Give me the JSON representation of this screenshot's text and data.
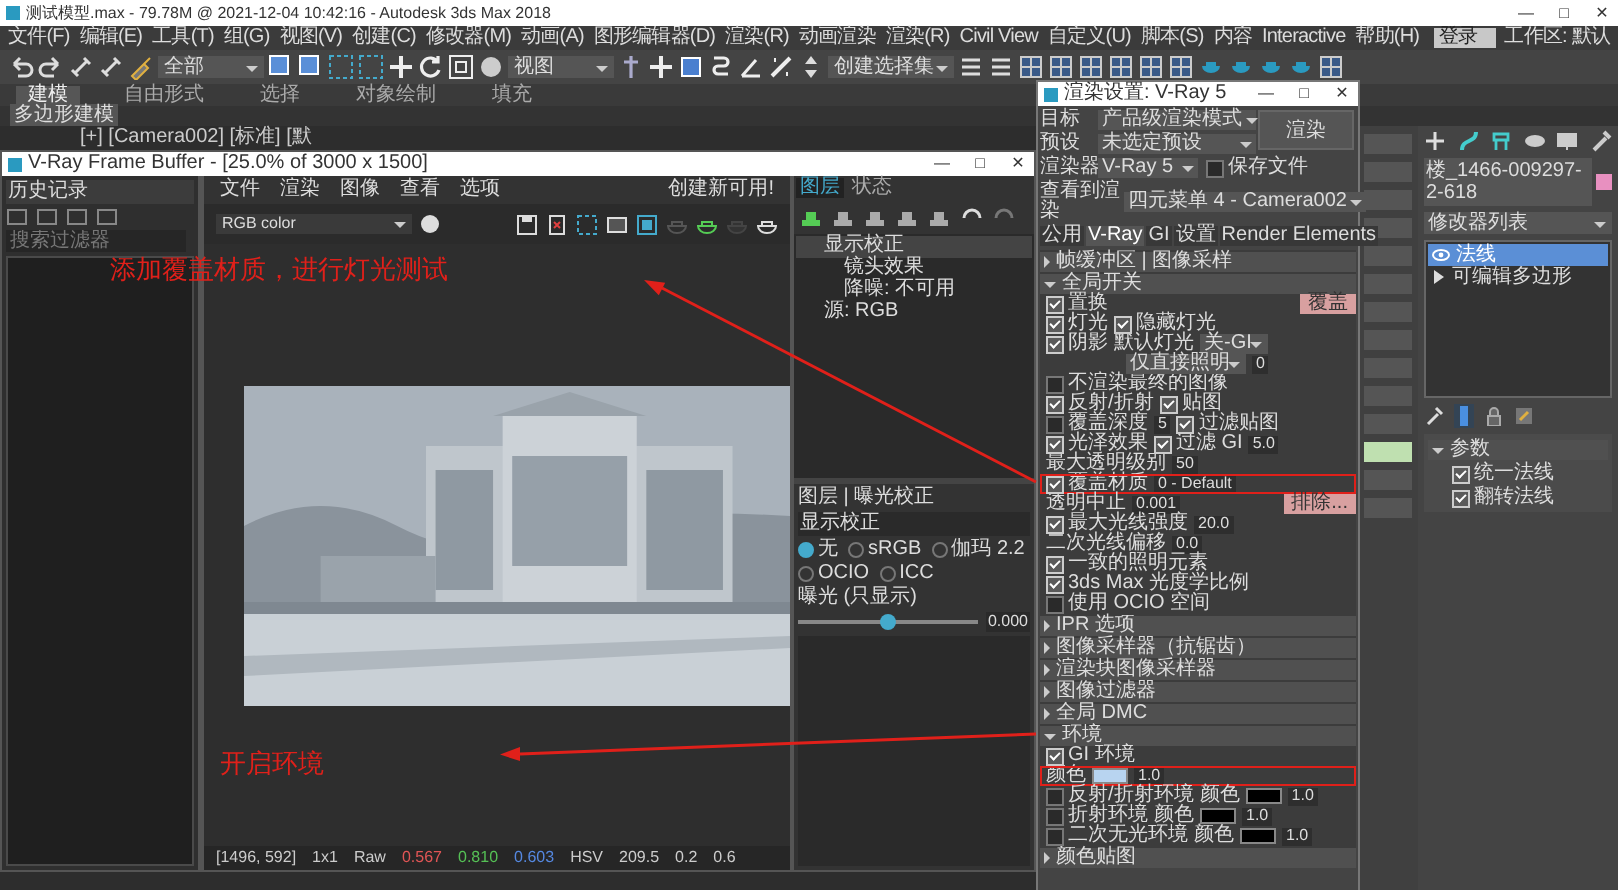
{
  "title_bar": {
    "title": "测试模型.max - 79.78M @ 2021-12-04 10:42:16 - Autodesk 3ds Max 2018",
    "controls": [
      "—",
      "□",
      "✕"
    ]
  },
  "menu_bar": [
    "文件(F)",
    "编辑(E)",
    "工具(T)",
    "组(G)",
    "视图(V)",
    "创建(C)",
    "修改器(M)",
    "动画(A)",
    "图形编辑器(D)",
    "渲染(R)",
    "动画渲染",
    "渲染(R)",
    "Civil View",
    "自定义(U)",
    "脚本(S)",
    "内容",
    "Interactive",
    "帮助(H)"
  ],
  "login": "登录",
  "workspace": "工作区: 默认",
  "toolbar": {
    "dropdowns": [
      "全部",
      "视图",
      "创建选择集"
    ]
  },
  "ribbon_tabs": [
    {
      "label": "建模",
      "selected": true
    },
    {
      "label": "自由形式",
      "selected": false
    },
    {
      "label": "选择",
      "selected": false
    },
    {
      "label": "对象绘制",
      "selected": false
    },
    {
      "label": "填充",
      "selected": false
    }
  ],
  "ribbon_panel": "多边形建模",
  "viewport_label": "[+] [Camera002] [标准] [默",
  "vfb": {
    "title": "V-Ray Frame Buffer - [25.0% of 3000 x 1500]",
    "controls": [
      "—",
      "□",
      "✕"
    ],
    "menus": [
      "文件",
      "渲染",
      "图像",
      "查看",
      "选项"
    ],
    "notice": "创建新可用!",
    "history_title": "历史记录",
    "history_search": {
      "placeholder": "搜索过滤器"
    },
    "channel": "RGB color",
    "layer_tabs": [
      {
        "label": "图层",
        "selected": true
      },
      {
        "label": "状态",
        "selected": false
      }
    ],
    "layers": [
      {
        "label": "显示校正",
        "selected": true,
        "children": [
          {
            "label": "镜头效果",
            "selected": false
          },
          {
            "label": "降噪: 不可用",
            "selected": false
          }
        ]
      },
      {
        "label": "源: RGB",
        "selected": false
      }
    ],
    "properties": {
      "title": "图层 | 曝光校正",
      "field": "显示校正",
      "options": [
        {
          "label": "无",
          "selected": true
        },
        {
          "label": "sRGB",
          "selected": false
        },
        {
          "label": "伽玛 2.2",
          "selected": false
        },
        {
          "label": "OCIO",
          "selected": false
        },
        {
          "label": "ICC",
          "selected": false
        }
      ],
      "slider": {
        "label": "曝光 (只显示)",
        "level": 0.5,
        "reading": "0.000"
      }
    },
    "status": [
      {
        "text": "[1496, 592]",
        "color": "#cccccc"
      },
      {
        "text": "1x1",
        "color": "#cccccc"
      },
      {
        "text": "Raw",
        "color": "#cccccc"
      },
      {
        "text": "0.567",
        "color": "#e05555"
      },
      {
        "text": "0.810",
        "color": "#55c055"
      },
      {
        "text": "0.603",
        "color": "#5588e0"
      },
      {
        "text": "HSV",
        "color": "#cccccc"
      },
      {
        "text": "209.5",
        "color": "#cccccc"
      },
      {
        "text": "0.2",
        "color": "#cccccc"
      },
      {
        "text": "0.6",
        "color": "#cccccc"
      }
    ]
  },
  "render_setup": {
    "title": "渲染设置: V-Ray 5",
    "controls": [
      "—",
      "□",
      "✕"
    ],
    "fields": [
      {
        "label": "目标",
        "value": "产品级渲染模式"
      },
      {
        "label": "预设",
        "value": "未选定预设"
      },
      {
        "label": "渲染器",
        "value": "V-Ray 5"
      }
    ],
    "render_button": "渲染",
    "save_file": {
      "label": "保存文件",
      "checked": false
    },
    "view": {
      "label": "查看到渲染",
      "value": "四元菜单 4 - Camera002"
    },
    "tabs": [
      {
        "label": "公用",
        "selected": false
      },
      {
        "label": "V-Ray",
        "selected": true
      },
      {
        "label": "GI",
        "selected": false
      },
      {
        "label": "设置",
        "selected": false
      },
      {
        "label": "Render Elements",
        "selected": false
      }
    ],
    "rollouts": [
      {
        "kind": "rollout",
        "title": "帧缓冲区 | 图像采样",
        "expanded": false
      },
      {
        "kind": "rollout",
        "title": "全局开关",
        "expanded": true
      },
      {
        "kind": "row",
        "highlighted": false,
        "cells": [
          {
            "kind": "check",
            "label": "置换",
            "checked": true
          },
          {
            "kind": "button",
            "label": "覆盖"
          }
        ]
      },
      {
        "kind": "row",
        "highlighted": false,
        "cells": [
          {
            "kind": "check",
            "label": "灯光",
            "checked": true
          },
          {
            "kind": "check",
            "label": "隐藏灯光",
            "checked": true
          }
        ]
      },
      {
        "kind": "row",
        "highlighted": false,
        "cells": [
          {
            "kind": "check",
            "label": "阴影",
            "checked": true
          },
          {
            "kind": "text",
            "label": "默认灯光"
          },
          {
            "kind": "dropdown",
            "value": "关-GI"
          }
        ]
      },
      {
        "kind": "row",
        "highlighted": false,
        "cells": [
          {
            "kind": "dropdown",
            "value": "仅直接照明"
          },
          {
            "kind": "value",
            "value": "0"
          }
        ]
      },
      {
        "kind": "row",
        "highlighted": false,
        "cells": [
          {
            "kind": "check",
            "label": "不渲染最终的图像",
            "checked": false
          }
        ]
      },
      {
        "kind": "row",
        "highlighted": false,
        "cells": [
          {
            "kind": "check",
            "label": "反射/折射",
            "checked": true
          },
          {
            "kind": "check",
            "label": "贴图",
            "checked": true
          }
        ]
      },
      {
        "kind": "row",
        "highlighted": false,
        "cells": [
          {
            "kind": "check",
            "label": "覆盖深度",
            "checked": false
          },
          {
            "kind": "value",
            "value": "5"
          },
          {
            "kind": "check",
            "label": "过滤贴图",
            "checked": true
          }
        ]
      },
      {
        "kind": "row",
        "highlighted": false,
        "cells": [
          {
            "kind": "check",
            "label": "光泽效果",
            "checked": true
          },
          {
            "kind": "check",
            "label": "过滤 GI",
            "checked": true
          },
          {
            "kind": "value",
            "value": "5.0"
          }
        ]
      },
      {
        "kind": "row",
        "highlighted": false,
        "cells": [
          {
            "kind": "text",
            "label": "最大透明级别"
          },
          {
            "kind": "value",
            "value": "50"
          }
        ]
      },
      {
        "kind": "row",
        "highlighted": true,
        "cells": [
          {
            "kind": "check",
            "label": "覆盖材质",
            "checked": true
          },
          {
            "kind": "value",
            "value": "0 - Default"
          }
        ]
      },
      {
        "kind": "row",
        "highlighted": false,
        "cells": [
          {
            "kind": "text",
            "label": "透明中止"
          },
          {
            "kind": "value",
            "value": "0.001"
          },
          {
            "kind": "button",
            "label": "排除..."
          }
        ]
      },
      {
        "kind": "row",
        "highlighted": false,
        "cells": [
          {
            "kind": "check",
            "label": "最大光线强度",
            "checked": true
          },
          {
            "kind": "value",
            "value": "20.0"
          }
        ]
      },
      {
        "kind": "row",
        "highlighted": false,
        "cells": [
          {
            "kind": "text",
            "label": "二次光线偏移"
          },
          {
            "kind": "value",
            "value": "0.0"
          }
        ]
      },
      {
        "kind": "row",
        "highlighted": false,
        "cells": [
          {
            "kind": "check",
            "label": "一致的照明元素",
            "checked": true
          }
        ]
      },
      {
        "kind": "row",
        "highlighted": false,
        "cells": [
          {
            "kind": "check",
            "label": "3ds Max 光度学比例",
            "checked": true
          }
        ]
      },
      {
        "kind": "row",
        "highlighted": false,
        "cells": [
          {
            "kind": "check",
            "label": "使用 OCIO 空间",
            "checked": false
          }
        ]
      },
      {
        "kind": "rollout",
        "title": "IPR 选项",
        "expanded": false
      },
      {
        "kind": "rollout",
        "title": "图像采样器（抗锯齿）",
        "expanded": false
      },
      {
        "kind": "rollout",
        "title": "渲染块图像采样器",
        "expanded": false
      },
      {
        "kind": "rollout",
        "title": "图像过滤器",
        "expanded": false
      },
      {
        "kind": "rollout",
        "title": "全局 DMC",
        "expanded": false
      },
      {
        "kind": "rollout",
        "title": "环境",
        "expanded": true
      },
      {
        "kind": "row",
        "highlighted": false,
        "cells": [
          {
            "kind": "check",
            "label": "GI 环境",
            "checked": true
          }
        ]
      },
      {
        "kind": "row",
        "highlighted": true,
        "cells": [
          {
            "kind": "text",
            "label": "颜色"
          },
          {
            "kind": "swatch",
            "color": "#b8d4f0"
          },
          {
            "kind": "value",
            "value": "1.0"
          }
        ]
      },
      {
        "kind": "row",
        "highlighted": false,
        "cells": [
          {
            "kind": "check",
            "label": "反射/折射环境",
            "checked": false
          },
          {
            "kind": "text",
            "label": "颜色"
          },
          {
            "kind": "swatch",
            "color": "#000000"
          },
          {
            "kind": "value",
            "value": "1.0"
          }
        ]
      },
      {
        "kind": "row",
        "highlighted": false,
        "cells": [
          {
            "kind": "check",
            "label": "折射环境",
            "checked": false
          },
          {
            "kind": "text",
            "label": "颜色"
          },
          {
            "kind": "swatch",
            "color": "#000000"
          },
          {
            "kind": "value",
            "value": "1.0"
          }
        ]
      },
      {
        "kind": "row",
        "highlighted": false,
        "cells": [
          {
            "kind": "check",
            "label": "二次无光环境",
            "checked": false
          },
          {
            "kind": "text",
            "label": "颜色"
          },
          {
            "kind": "swatch",
            "color": "#000000"
          },
          {
            "kind": "value",
            "value": "1.0"
          }
        ]
      },
      {
        "kind": "rollout",
        "title": "颜色贴图",
        "expanded": false
      }
    ]
  },
  "command_panel": {
    "object_name": "楼_1466-009297-2-618",
    "modifier_list": "修改器列表",
    "stack": [
      {
        "label": "法线",
        "kind": "modifier",
        "selected": true
      },
      {
        "label": "可编辑多边形",
        "kind": "base",
        "selected": false
      }
    ],
    "rollout": "参数",
    "checks": [
      {
        "label": "统一法线",
        "checked": true
      },
      {
        "label": "翻转法线",
        "checked": true
      }
    ]
  },
  "annotations": [
    {
      "text": "添加覆盖材质，进行灯光测试"
    },
    {
      "text": "开启环境"
    }
  ]
}
